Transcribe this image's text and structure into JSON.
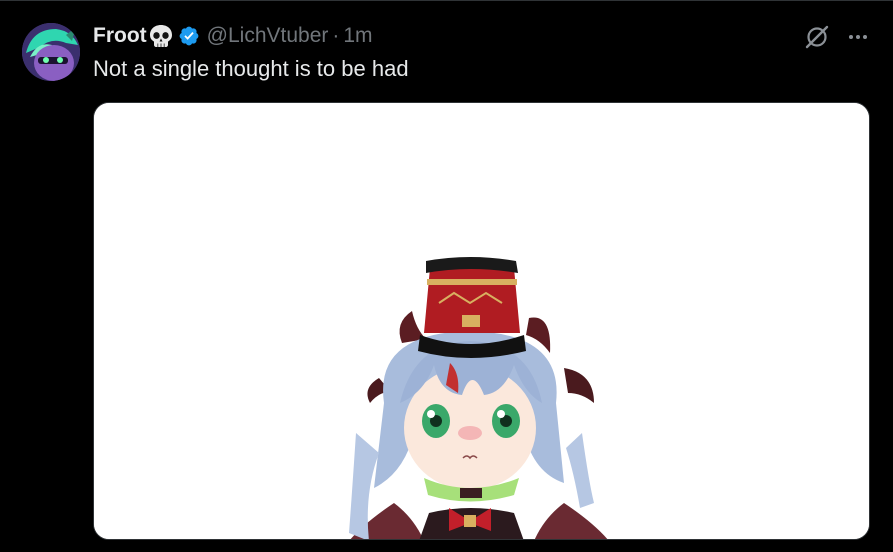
{
  "tweet": {
    "display_name": "Froot",
    "handle": "@LichVtuber",
    "separator": "·",
    "timestamp": "1m",
    "text": "Not a single thought is to be had",
    "name_emoji": "skull-icon",
    "verified": true
  },
  "icons": {
    "verified_badge": "verified-badge-icon",
    "grok": "grok-icon",
    "more": "more-options-icon"
  },
  "colors": {
    "background": "#000000",
    "text_primary": "#e7e9ea",
    "text_secondary": "#71767b",
    "verified_blue": "#1d9bf0",
    "media_background": "#ffffff"
  }
}
